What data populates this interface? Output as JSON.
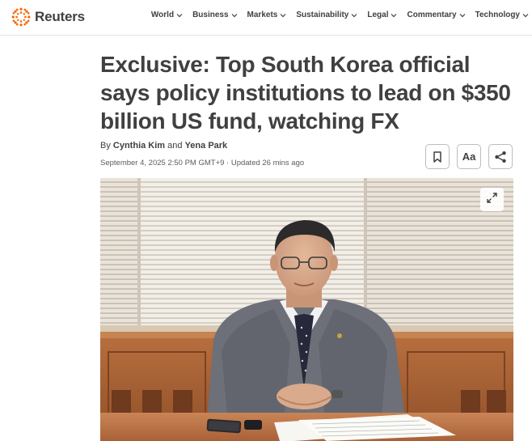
{
  "brand": {
    "name": "Reuters",
    "accent": "#fa6400"
  },
  "nav": {
    "items": [
      {
        "label": "World"
      },
      {
        "label": "Business"
      },
      {
        "label": "Markets"
      },
      {
        "label": "Sustainability"
      },
      {
        "label": "Legal"
      },
      {
        "label": "Commentary"
      },
      {
        "label": "Technology"
      }
    ]
  },
  "article": {
    "headline": "Exclusive: Top South Korea official says policy institutions to lead on $350 billion US fund, watching FX",
    "byline_prefix": "By",
    "authors": [
      "Cynthia Kim",
      "Yena Park"
    ],
    "byline_joiner": "and",
    "dateline": "September 4, 2025 2:50 PM GMT+9 · Updated 26 mins ago"
  },
  "actions": {
    "bookmark_icon": "bookmark-icon",
    "text_size_label": "Aa",
    "share_icon": "share-icon"
  },
  "photo": {
    "expand_icon": "expand-icon"
  }
}
